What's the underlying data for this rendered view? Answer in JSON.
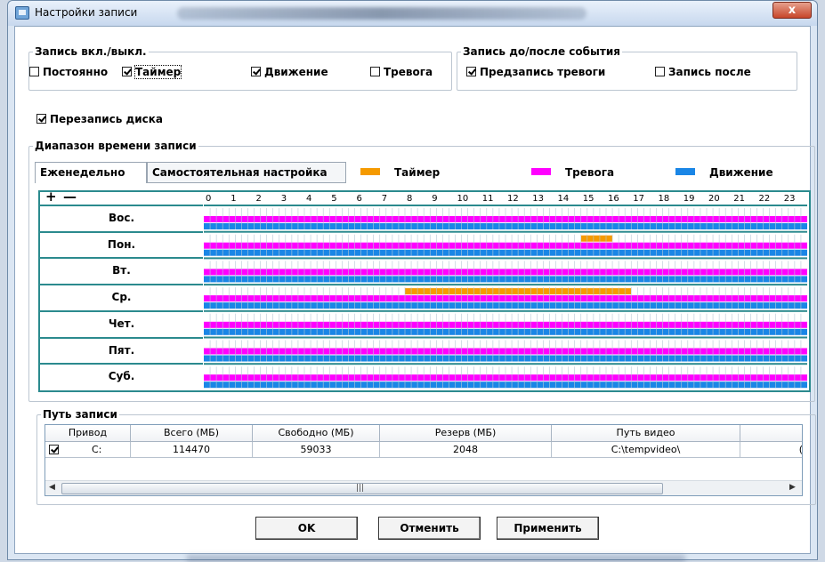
{
  "window": {
    "title": "Настройки записи",
    "close": "x"
  },
  "record_onoff": {
    "title": "Запись вкл./выкл.",
    "items": [
      {
        "label": "Постоянно",
        "checked": false
      },
      {
        "label": "Таймер",
        "checked": true
      },
      {
        "label": "Движение",
        "checked": true
      },
      {
        "label": "Тревога",
        "checked": false
      }
    ]
  },
  "record_event": {
    "title": "Запись до/после события",
    "items": [
      {
        "label": "Предзапись тревоги",
        "checked": true
      },
      {
        "label": "Запись после",
        "checked": false
      }
    ]
  },
  "overwrite": {
    "label": "Перезапись диска",
    "checked": true
  },
  "schedule": {
    "title": "Диапазон времени записи",
    "tabs": [
      "Еженедельно",
      "Самостоятельная настройка"
    ],
    "legend": [
      {
        "label": "Таймер",
        "color": "#f59a00"
      },
      {
        "label": "Тревога",
        "color": "#ff00ff"
      },
      {
        "label": "Движение",
        "color": "#1a86e6"
      }
    ],
    "plus": "+",
    "minus": "—",
    "hours": [
      "0",
      "1",
      "2",
      "3",
      "4",
      "5",
      "6",
      "7",
      "8",
      "9",
      "10",
      "11",
      "12",
      "13",
      "14",
      "15",
      "16",
      "17",
      "18",
      "19",
      "20",
      "21",
      "22",
      "23"
    ],
    "days": [
      "Вос.",
      "Пон.",
      "Вт.",
      "Ср.",
      "Чет.",
      "Пят.",
      "Суб."
    ],
    "timer_ranges": [
      [],
      [
        [
          15,
          16.25
        ]
      ],
      [],
      [
        [
          8,
          17
        ]
      ],
      [],
      [],
      []
    ]
  },
  "path": {
    "title": "Путь записи",
    "columns": [
      "Привод",
      "Всего (МБ)",
      "Свободно (МБ)",
      "Резерв (МБ)",
      "Путь видео"
    ],
    "row": {
      "checked": true,
      "drive": "C:",
      "total": "114470",
      "free": "59033",
      "reserve": "2048",
      "video_path": "C:\\tempvideo\\",
      "extra": "("
    }
  },
  "buttons": {
    "ok": "OK",
    "cancel": "Отменить",
    "apply": "Применить"
  }
}
